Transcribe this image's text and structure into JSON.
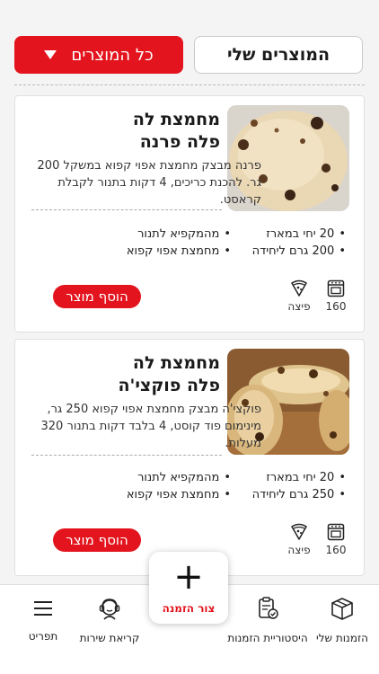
{
  "header": {
    "my_products": "המוצרים שלי",
    "all_products": "כל המוצרים"
  },
  "products": [
    {
      "title": "מחמצת לה פלה פרנה",
      "description": "פרנה מבצק מחמצת אפוי קפוא במשקל 200 גר. להכנת כריכים, 4 דקות בתנור לקבלת קראסט.",
      "specs_left": [
        "מהמקפיא לתנור",
        "מחמצת אפוי קפוא"
      ],
      "specs_right": [
        "20 יחי במארז",
        "200 גרם ליחידה"
      ],
      "add_label": "הוסף מוצר",
      "oven_temp": "160",
      "dish": "פיצה"
    },
    {
      "title": "מחמצת לה פלה פוקצי'ה",
      "description": "פוקצי'ה מבצק מחמצת אפוי קפוא 250 גר, מינימום פוד קוסט, 4 בלבד דקות בתנור 320 מעלות.",
      "specs_left": [
        "מהמקפיא לתנור",
        "מחמצת אפוי קפוא"
      ],
      "specs_right": [
        "20 יחי במארז",
        "250 גרם ליחידה"
      ],
      "add_label": "הוסף מוצר",
      "oven_temp": "160",
      "dish": "פיצה"
    }
  ],
  "bottom_nav": {
    "menu": "תפריט",
    "service": "קריאת שירות",
    "create_order": "צור הזמנה",
    "history": "היסטוריית הזמנות",
    "my_orders": "הזמנות שלי"
  },
  "colors": {
    "accent": "#e3141e"
  }
}
